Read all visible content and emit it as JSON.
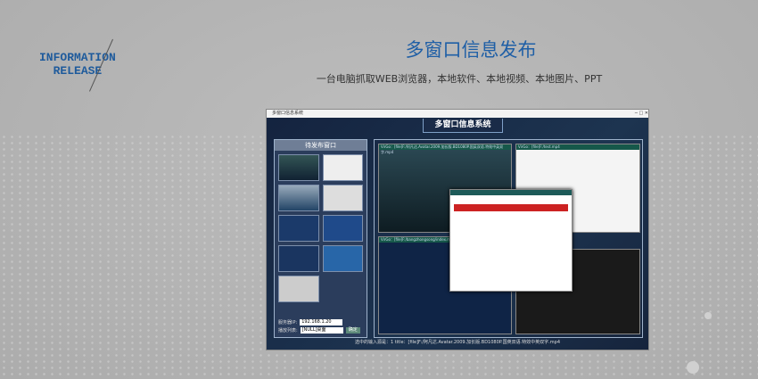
{
  "heading": {
    "brand_line1": "INFORMATION",
    "brand_line2": "RELEASE",
    "title": "多窗口信息发布",
    "subtitle": "一台电脑抓取WEB浏览器，本地软件、本地视频、本地图片、PPT"
  },
  "screenshot": {
    "window_title": "多窗口信息系统",
    "system_name": "多窗口信息系统",
    "left_panel_title": "待发布窗口",
    "server_ip_label": "服务器IP:",
    "server_ip": "192.168.1.20",
    "list_label": "播放列表:",
    "list_value": "[NULL]桌面",
    "ok_label": "确定",
    "caption": "选中的输入源是：1 title：[file]F:/阿凡达.Avatar.2009.加长版.BD1080P.国英双语.特效中英双字.mp4",
    "win_title_1": "VirGo：[file]F:/阿凡达.Avatar.2009.加长版.BD1080P.国英双语.特效中英双字.mp4",
    "win_title_2": "VirGo：[file]F:/test.mp4",
    "win_title_3": "VirGo：[file]F:/bangzhongsong/index.mp4"
  },
  "colors": {
    "title": "#1f5fa6",
    "panel": "#14233f"
  }
}
